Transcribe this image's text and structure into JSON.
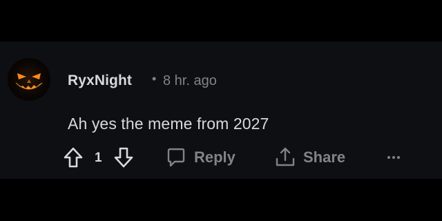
{
  "comment": {
    "author": "RyxNight",
    "separator": "•",
    "timestamp": "8 hr. ago",
    "body": "Ah yes the meme from 2027",
    "vote_count": "1"
  },
  "actions": {
    "reply_label": "Reply",
    "share_label": "Share"
  },
  "icons": {
    "upvote": "arrow-up-outline-icon",
    "downvote": "arrow-down-outline-icon",
    "reply": "speech-bubble-icon",
    "share": "share-upload-icon",
    "more": "ellipsis-icon"
  },
  "colors": {
    "background": "#000000",
    "panel": "#0d0f12",
    "text_primary": "#d7dadc",
    "text_secondary": "#818384",
    "avatar_glow": "#ff8a1a"
  }
}
